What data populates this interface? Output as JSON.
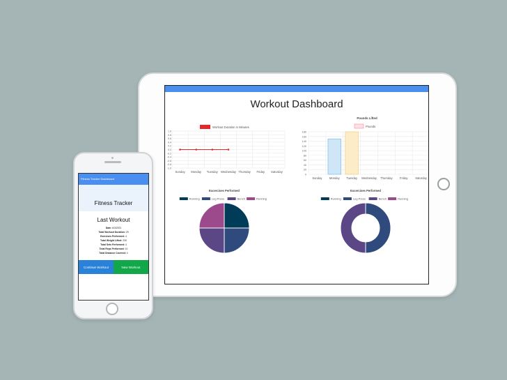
{
  "dashboard": {
    "title": "Workout Dashboard",
    "colors": {
      "header": "#4a8ef0",
      "line": "#e8262a"
    }
  },
  "chart_data": [
    {
      "type": "line",
      "title": "",
      "legend": [
        "Workout Duration in Minutes"
      ],
      "legend_placement": "top",
      "categories": [
        "Sunday",
        "Monday",
        "Tuesday",
        "Wednesday",
        "Thursday",
        "Friday",
        "Saturday"
      ],
      "series": [
        {
          "name": "Workout Duration in Minutes",
          "values": [
            0,
            0,
            0,
            0,
            null,
            null,
            null
          ]
        }
      ],
      "ytick_labels": [
        "1.0",
        "0.8",
        "0.6",
        "0.4",
        "0.2",
        "0.0",
        "-0.2",
        "-0.4",
        "-0.6",
        "-0.8",
        "-1.0"
      ],
      "ylim": [
        -1,
        1
      ],
      "grid": true
    },
    {
      "type": "bar",
      "title": "Pounds Lifted",
      "legend": [
        "Pounds"
      ],
      "legend_placement": "top",
      "categories": [
        "Sunday",
        "Monday",
        "Tuesday",
        "Wednesday",
        "Thursday",
        "Friday",
        "Saturday"
      ],
      "series": [
        {
          "name": "Pounds",
          "values": [
            0,
            150,
            190,
            0,
            0,
            0,
            0
          ]
        }
      ],
      "ytick_labels": [
        "180",
        "160",
        "140",
        "120",
        "100",
        "80",
        "60",
        "40",
        "20",
        "0"
      ],
      "ylim": [
        0,
        180
      ],
      "bar_colors": [
        "#cfe6f7",
        "#cfe6f7",
        "#fdecc8"
      ],
      "bar_borders": [
        "#6fb2e8",
        "#6fb2e8",
        "#f3c770"
      ],
      "grid": true
    },
    {
      "type": "pie",
      "title": "Excercises Performed",
      "legend": [
        "Running",
        "Leg Press",
        "Bench",
        "Running"
      ],
      "legend_placement": "top",
      "values": [
        1,
        1,
        1,
        1
      ],
      "colors": [
        "#003b57",
        "#2f4a7d",
        "#5b4786",
        "#9d4a8c"
      ]
    },
    {
      "type": "pie",
      "title": "Excercises Performed",
      "legend": [
        "Running",
        "Leg Press",
        "Bench",
        "Running"
      ],
      "legend_placement": "top",
      "donut": true,
      "values": [
        0,
        1,
        1,
        0
      ],
      "colors": [
        "#003b57",
        "#2f4a7d",
        "#5b4786",
        "#9d4a8c"
      ]
    }
  ],
  "phone": {
    "nav_title": "Fitness Tracker Dashboard",
    "app_title": "Fitness Tracker",
    "last_workout": {
      "heading": "Last Workout",
      "rows": [
        {
          "label": "Date:",
          "value": "6/3/2021"
        },
        {
          "label": "Total Workout Duration:",
          "value": "29"
        },
        {
          "label": "Exercises Performed:",
          "value": "4"
        },
        {
          "label": "Total Weight Lifted:",
          "value": "230"
        },
        {
          "label": "Total Sets Performed:",
          "value": "4"
        },
        {
          "label": "Total Reps Performed:",
          "value": "10"
        },
        {
          "label": "Total Distance Covered:",
          "value": "4"
        }
      ]
    },
    "buttons": {
      "continue": "Continue Workout",
      "new": "New Workout"
    }
  }
}
